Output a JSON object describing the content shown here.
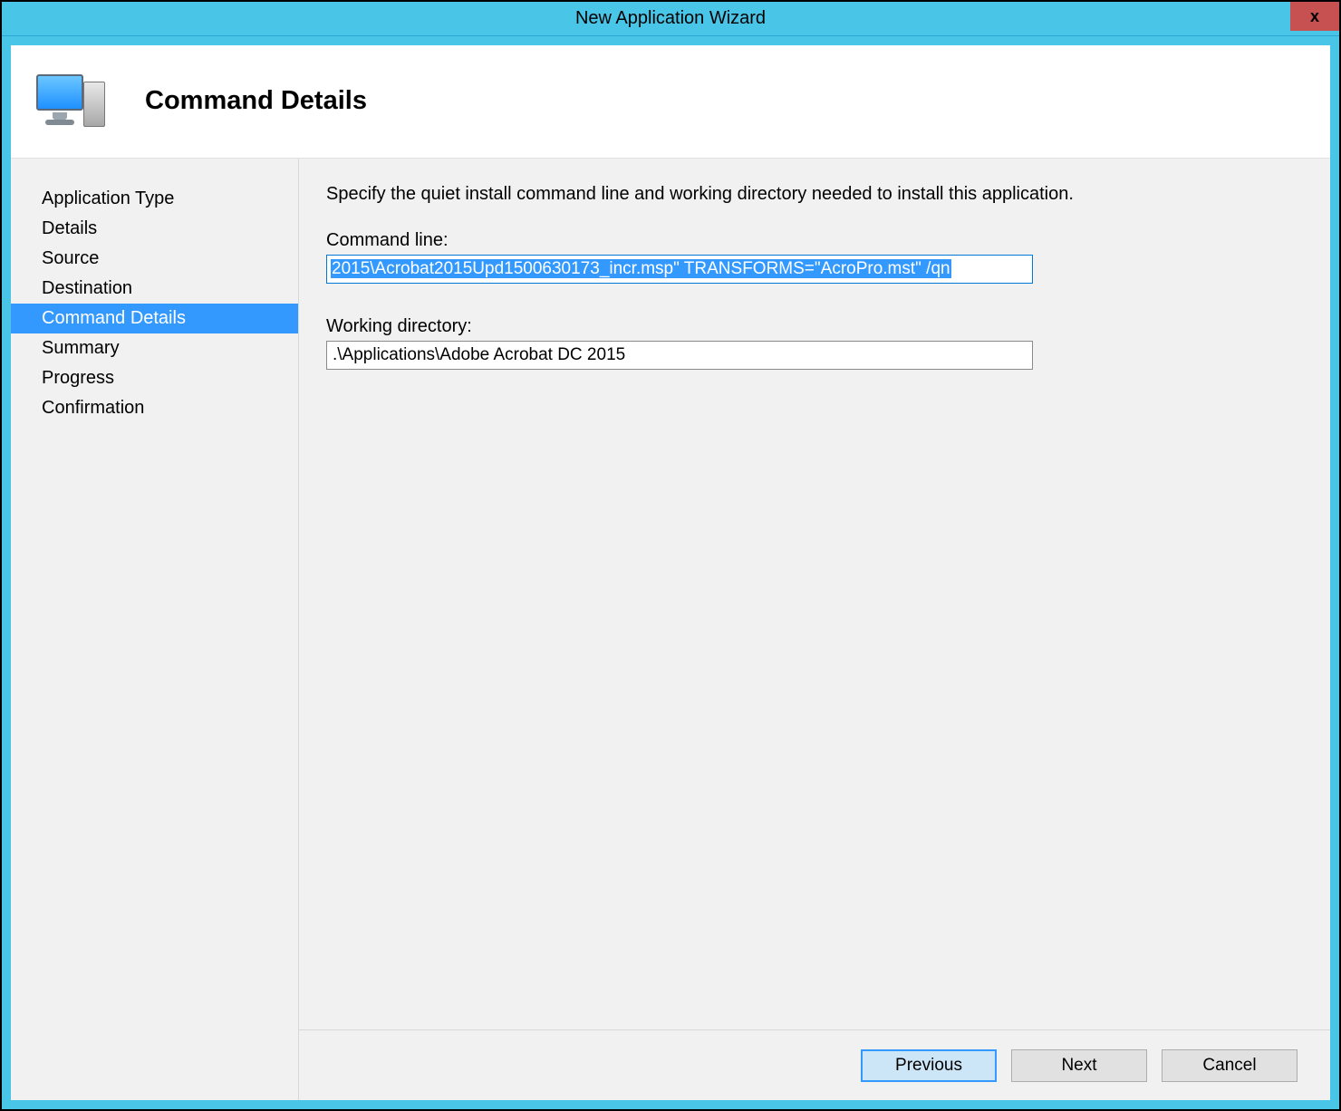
{
  "window": {
    "title": "New Application Wizard",
    "close_glyph": "x"
  },
  "header": {
    "title": "Command Details"
  },
  "sidebar": {
    "items": [
      {
        "label": "Application Type"
      },
      {
        "label": "Details"
      },
      {
        "label": "Source"
      },
      {
        "label": "Destination"
      },
      {
        "label": "Command Details"
      },
      {
        "label": "Summary"
      },
      {
        "label": "Progress"
      },
      {
        "label": "Confirmation"
      }
    ],
    "selected_index": 4
  },
  "main": {
    "instruction": "Specify the quiet install command line and working directory needed to install this application.",
    "command_line_label": "Command line:",
    "command_line_value": "2015\\Acrobat2015Upd1500630173_incr.msp\" TRANSFORMS=\"AcroPro.mst\"  /qn",
    "working_dir_label": "Working directory:",
    "working_dir_value": ".\\Applications\\Adobe Acrobat DC 2015"
  },
  "buttons": {
    "previous": "Previous",
    "next": "Next",
    "cancel": "Cancel"
  }
}
